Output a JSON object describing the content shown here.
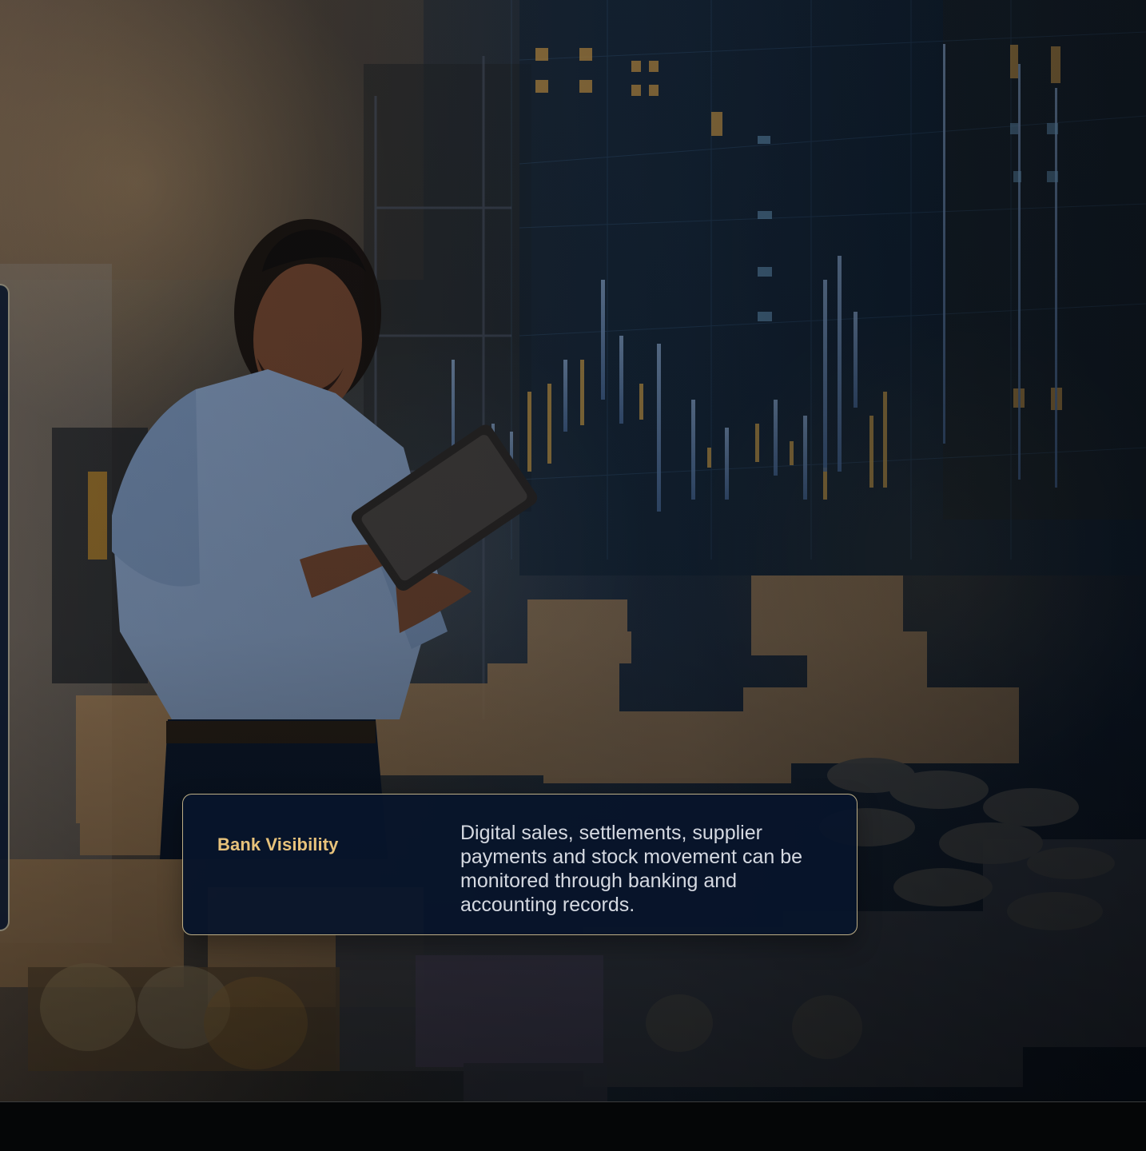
{
  "card": {
    "title": "Bank Visibility",
    "description": "Digital sales, settlements, supplier payments and stock movement can be monitored through banking and accounting records."
  },
  "icons": {
    "overlay": "warehouse-analytics-overlay"
  },
  "colors": {
    "card_background": "#07142b",
    "card_border": "#dcc996",
    "title": "#e7c27b",
    "body_text": "#d5d9e1"
  }
}
